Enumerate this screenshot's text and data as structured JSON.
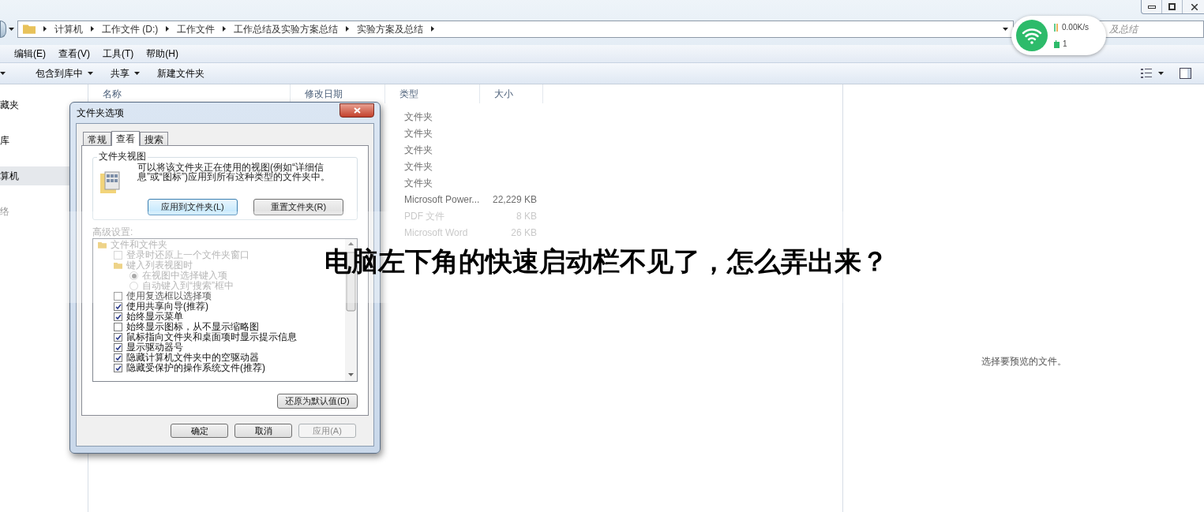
{
  "address_bar": {
    "path": [
      "计算机",
      "工作文件 (D:)",
      "工作文件",
      "工作总结及实验方案总结",
      "实验方案及总结"
    ]
  },
  "search": {
    "placeholder": "及总结"
  },
  "net_widget": {
    "speed": "0.00K/s",
    "devices": "1"
  },
  "menu": [
    "编辑(E)",
    "查看(V)",
    "工具(T)",
    "帮助(H)"
  ],
  "toolbar": [
    {
      "label": "包含到库中",
      "dropdown": true
    },
    {
      "label": "共享",
      "dropdown": true
    },
    {
      "label": "新建文件夹",
      "dropdown": false
    }
  ],
  "sidebar": {
    "items": [
      {
        "label": "藏夹",
        "selected": false
      },
      {
        "label": "库",
        "selected": false
      },
      {
        "label": "算机",
        "selected": true
      },
      {
        "label": "络",
        "selected": false
      }
    ]
  },
  "table": {
    "columns": [
      "名称",
      "修改日期",
      "类型",
      "大小"
    ],
    "rows": [
      {
        "type": "文件夹"
      },
      {
        "type": "文件夹"
      },
      {
        "type": "文件夹"
      },
      {
        "type": "文件夹"
      },
      {
        "type": "文件夹"
      },
      {
        "type": "Microsoft Power...",
        "size": "22,229 KB"
      },
      {
        "type": "PDF 文件",
        "size": "8 KB"
      },
      {
        "type": "Microsoft Word",
        "size": "26 KB"
      }
    ]
  },
  "preview": {
    "message": "选择要预览的文件。"
  },
  "dialog": {
    "title": "文件夹选项",
    "tabs": [
      {
        "label": "常规",
        "selected": false
      },
      {
        "label": "查看",
        "selected": true
      },
      {
        "label": "搜索",
        "selected": false
      }
    ],
    "group_title": "文件夹视图",
    "description": "可以将该文件夹正在使用的视图(例如“详细信息”或“图标”)应用到所有这种类型的文件夹中。",
    "group_buttons": [
      {
        "label": "应用到文件夹(L)",
        "selected": true
      },
      {
        "label": "重置文件夹(R)",
        "selected": false
      }
    ],
    "advanced_label": "高级设置:",
    "advanced": [
      {
        "kind": "folder",
        "label": "文件和文件夹",
        "disabled": true,
        "children": [
          {
            "kind": "checkbox",
            "label": "登录时还原上一个文件夹窗口",
            "checked": false,
            "disabled": true
          },
          {
            "kind": "folder",
            "label": "键入列表视图时",
            "disabled": true,
            "children": [
              {
                "kind": "radio",
                "label": "在视图中选择键入项",
                "selected": true,
                "disabled": true
              },
              {
                "kind": "radio",
                "label": "自动键入到“搜索”框中",
                "selected": false,
                "disabled": true
              }
            ]
          },
          {
            "kind": "checkbox",
            "label": "使用复选框以选择项",
            "checked": false,
            "disabled": false
          },
          {
            "kind": "checkbox",
            "label": "使用共享向导(推荐)",
            "checked": true,
            "disabled": false
          },
          {
            "kind": "checkbox",
            "label": "始终显示菜单",
            "checked": true,
            "disabled": false
          },
          {
            "kind": "checkbox",
            "label": "始终显示图标，从不显示缩略图",
            "checked": false,
            "disabled": false
          },
          {
            "kind": "checkbox",
            "label": "鼠标指向文件夹和桌面项时显示提示信息",
            "checked": true,
            "disabled": false
          },
          {
            "kind": "checkbox",
            "label": "显示驱动器号",
            "checked": true,
            "disabled": false
          },
          {
            "kind": "checkbox",
            "label": "隐藏计算机文件夹中的空驱动器",
            "checked": true,
            "disabled": false
          },
          {
            "kind": "checkbox",
            "label": "隐藏受保护的操作系统文件(推荐)",
            "checked": true,
            "disabled": false
          }
        ]
      }
    ],
    "restore_button": {
      "label": "还原为默认值(D)"
    },
    "footer_buttons": [
      {
        "label": "确定",
        "disabled": false
      },
      {
        "label": "取消",
        "disabled": false
      },
      {
        "label": "应用(A)",
        "disabled": true
      }
    ]
  },
  "banner": {
    "text": "电脑左下角的快速启动栏不见了，怎么弄出来？"
  }
}
